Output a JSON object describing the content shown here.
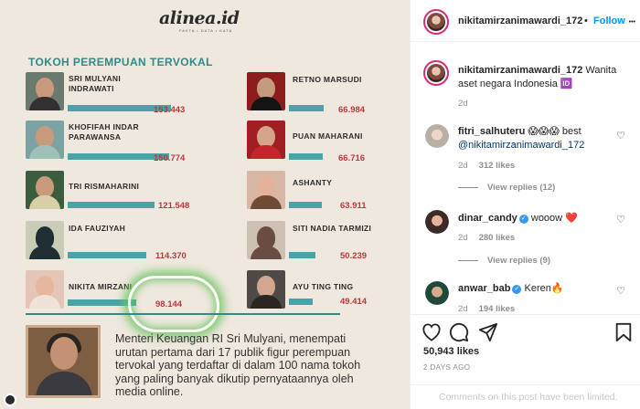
{
  "infographic": {
    "brand": "alinea.id",
    "brand_sub": "FAKTA • DATA • KATA",
    "title": "TOKOH PEREMPUAN TERVOKAL",
    "left_column": [
      {
        "name": "SRI MULYANI INDRAWATI",
        "value": "153.443"
      },
      {
        "name": "KHOFIFAH INDAR PARAWANSA",
        "value": "150.774"
      },
      {
        "name": "TRI RISMAHARINI",
        "value": "121.548"
      },
      {
        "name": "IDA FAUZIYAH",
        "value": "114.370"
      },
      {
        "name": "NIKITA MIRZANI",
        "value": "98.144"
      }
    ],
    "right_column": [
      {
        "name": "RETNO MARSUDI",
        "value": "66.984"
      },
      {
        "name": "PUAN MAHARANI",
        "value": "66.716"
      },
      {
        "name": "ASHANTY",
        "value": "63.911"
      },
      {
        "name": "SITI NADIA TARMIZI",
        "value": "50.239"
      },
      {
        "name": "AYU TING TING",
        "value": "49.414"
      }
    ],
    "caption": "Menteri Keuangan RI Sri Mulyani, menempati urutan pertama dari 17 publik figur perempuan tervokal yang terdaftar di dalam 100 nama tokoh yang paling banyak dikutip pernyataannya oleh media online."
  },
  "post": {
    "author": "nikitamirzanimawardi_172",
    "separator": "•",
    "follow_label": "Follow",
    "more_label": "•••",
    "author_caption": "Wanita aset negara Indonesia 🆔",
    "caption_age": "2d"
  },
  "comments": [
    {
      "username": "fitri_salhuteru",
      "verified": false,
      "text": "😱😱😱 best",
      "mention": "@nikitamirzanimawardi_172",
      "age": "2d",
      "likes": "312 likes",
      "replies": "View replies (12)"
    },
    {
      "username": "dinar_candy",
      "verified": true,
      "text": "wooow ❤️",
      "age": "2d",
      "likes": "280 likes",
      "replies": "View replies (9)"
    },
    {
      "username": "anwar_bab",
      "verified": true,
      "text": "Keren🔥",
      "age": "2d",
      "likes": "194 likes"
    }
  ],
  "footer": {
    "likes_count": "50,943 likes",
    "posted_ago": "2 DAYS AGO",
    "comments_limited": "Comments on this post have been limited."
  },
  "icons": {
    "like": "heart-icon",
    "comment": "comment-icon",
    "share": "share-icon",
    "save": "bookmark-icon"
  },
  "colors": {
    "accent": "#0095f6",
    "bar": "#4aa3a6",
    "value_red": "#b63a3a",
    "title_teal": "#2f8a88",
    "highlight_green": "#6bc45d"
  }
}
